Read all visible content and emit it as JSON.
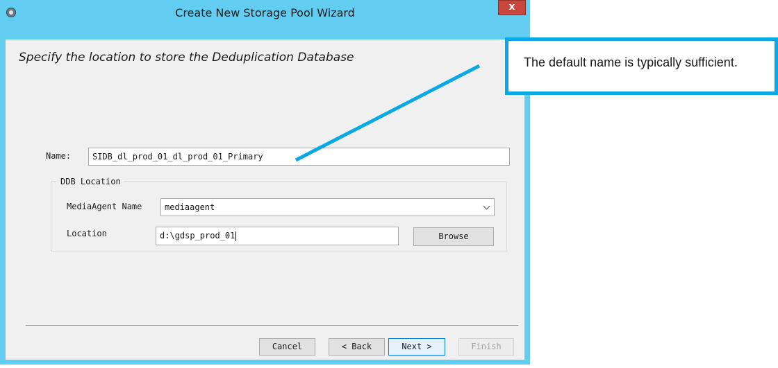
{
  "window": {
    "title": "Create New Storage Pool Wizard",
    "close_glyph": "x"
  },
  "page": {
    "heading": "Specify the location to store the Deduplication Database"
  },
  "form": {
    "name_label": "Name:",
    "name_value": "SIDB_dl_prod_01_dl_prod_01_Primary",
    "ddb_group_title": "DDB Location",
    "mediaagent_label": "MediaAgent Name",
    "mediaagent_value": "mediaagent",
    "location_label": "Location",
    "location_value": "d:\\gdsp_prod_01",
    "browse_label": "Browse"
  },
  "footer": {
    "cancel_label": "Cancel",
    "back_label": "< Back",
    "next_label": "Next >",
    "finish_label": "Finish"
  },
  "callout": {
    "text": "The default name is typically sufficient."
  },
  "icons": [
    "app-logo-icon",
    "close-icon",
    "chevron-down-icon"
  ],
  "colors": {
    "titlebar": "#62cdf0",
    "client": "#f0f0f0",
    "close_button": "#c9463d",
    "callout_border": "#0aa8e4",
    "focus_border": "#0078d7"
  }
}
